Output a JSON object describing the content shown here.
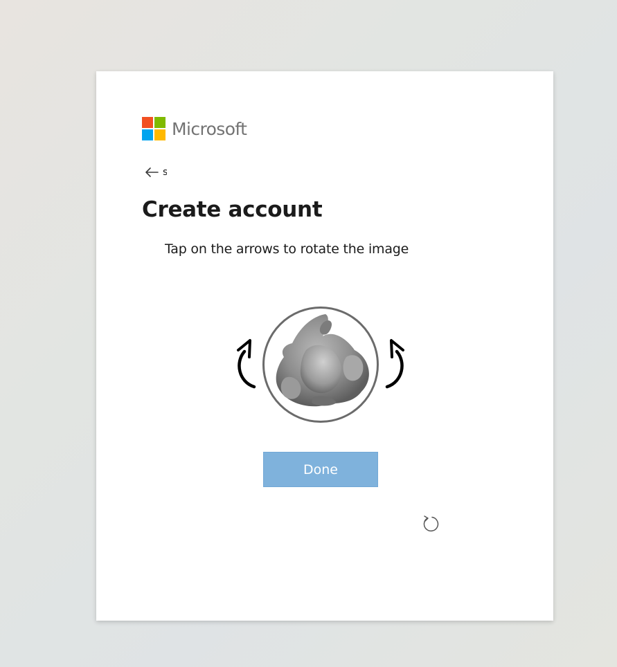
{
  "brand": {
    "name": "Microsoft",
    "logo_colors": [
      "#f25022",
      "#7fba00",
      "#00a4ef",
      "#ffb900"
    ]
  },
  "back": {
    "icon": "arrow-left-icon",
    "email_fragment": "s"
  },
  "page": {
    "title": "Create account",
    "instruction": "Tap on the arrows to rotate the image"
  },
  "puzzle": {
    "rotate_left_icon": "rotate-counterclockwise-icon",
    "rotate_right_icon": "rotate-clockwise-icon",
    "image_description": "grayscale rotated object"
  },
  "actions": {
    "done_label": "Done",
    "reload_icon": "refresh-icon"
  },
  "colors": {
    "primary_button": "#7fb2dc",
    "text": "#1b1b1b",
    "logo_text": "#737373"
  }
}
